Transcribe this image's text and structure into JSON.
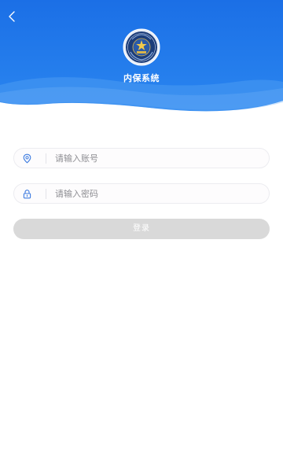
{
  "header": {
    "title": "内保系统",
    "back_icon": "chevron-left-icon",
    "emblem_icon": "police-emblem-icon"
  },
  "form": {
    "account": {
      "icon": "location-pin-icon",
      "placeholder": "请输入账号",
      "value": ""
    },
    "password": {
      "icon": "lock-icon",
      "placeholder": "请输入密码",
      "value": ""
    },
    "login_label": "登录"
  },
  "colors": {
    "header_blue": "#1a73e8",
    "button_disabled": "#d9d9d9",
    "icon_blue": "#3d7be0"
  }
}
